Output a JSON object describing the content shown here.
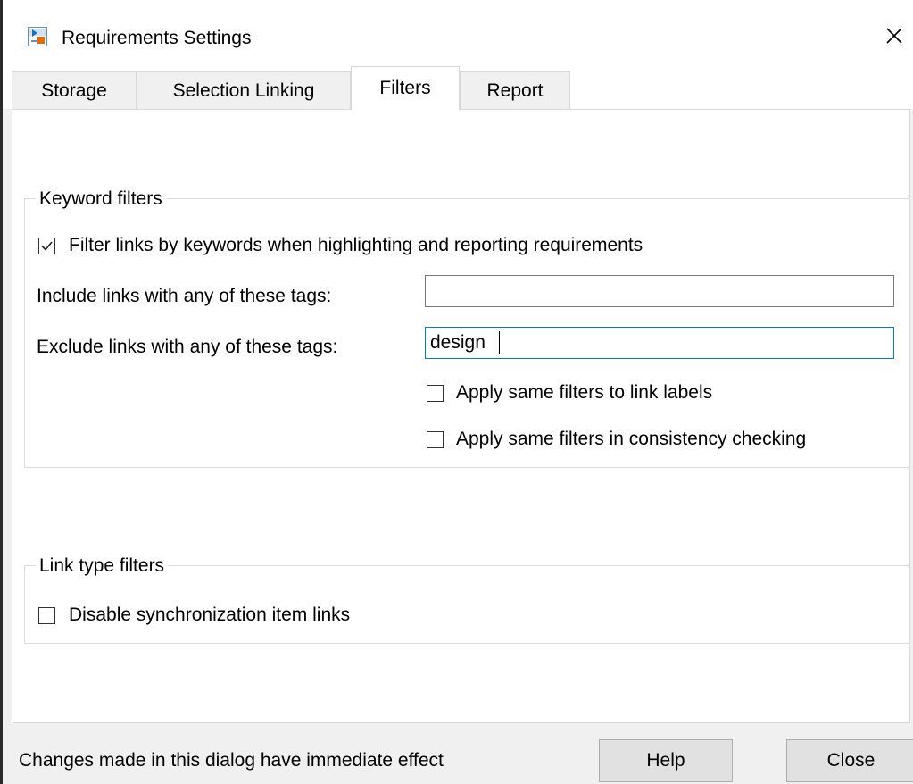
{
  "window": {
    "title": "Requirements Settings",
    "icon": "simulink-model-icon",
    "close_icon": "close-icon"
  },
  "tabs": [
    {
      "label": "Storage",
      "active": false
    },
    {
      "label": "Selection Linking",
      "active": false
    },
    {
      "label": "Filters",
      "active": true
    },
    {
      "label": "Report",
      "active": false
    }
  ],
  "keyword_filters": {
    "group_label": "Keyword filters",
    "filter_checkbox": {
      "label": "Filter links by keywords when highlighting and reporting requirements",
      "checked": true
    },
    "include": {
      "label": "Include links with any of these tags:",
      "value": ""
    },
    "exclude": {
      "label": "Exclude links with any of these tags:",
      "value": "design"
    },
    "apply_labels": {
      "label": "Apply same filters to link labels",
      "checked": false
    },
    "apply_consistency": {
      "label": "Apply same filters in consistency checking",
      "checked": false
    }
  },
  "link_type_filters": {
    "group_label": "Link type filters",
    "disable_sync": {
      "label": "Disable synchronization item links",
      "checked": false
    }
  },
  "footer": {
    "status_text": "Changes made in this dialog have immediate effect",
    "help_label": "Help",
    "close_label": "Close"
  },
  "colors": {
    "focus_border": "#0078d7",
    "panel_background": "#ffffff",
    "dialog_background": "#f0f0f0"
  }
}
